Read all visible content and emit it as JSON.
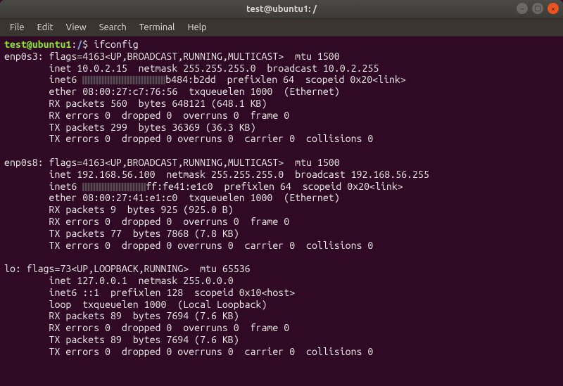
{
  "window": {
    "title": "test@ubuntu1: /"
  },
  "menubar": {
    "items": [
      "File",
      "Edit",
      "View",
      "Search",
      "Terminal",
      "Help"
    ]
  },
  "prompt": {
    "userhost": "test@ubuntu1",
    "sep": ":",
    "path": "/",
    "dollar": "$",
    "command": "ifconfig"
  },
  "output": {
    "enp0s3": {
      "l1": "enp0s3: flags=4163<UP,BROADCAST,RUNNING,MULTICAST>  mtu 1500",
      "l2": "        inet 10.0.2.15  netmask 255.255.255.0  broadcast 10.0.2.255",
      "l3a": "        inet6 ",
      "l3b": "b484:b2dd  prefixlen 64  scopeid 0x20<link>",
      "l4": "        ether 08:00:27:c7:76:56  txqueuelen 1000  (Ethernet)",
      "l5": "        RX packets 560  bytes 648121 (648.1 KB)",
      "l6": "        RX errors 0  dropped 0  overruns 0  frame 0",
      "l7": "        TX packets 299  bytes 36369 (36.3 KB)",
      "l8": "        TX errors 0  dropped 0 overruns 0  carrier 0  collisions 0"
    },
    "enp0s8": {
      "l1": "enp0s8: flags=4163<UP,BROADCAST,RUNNING,MULTICAST>  mtu 1500",
      "l2": "        inet 192.168.56.100  netmask 255.255.255.0  broadcast 192.168.56.255",
      "l3a": "        inet6 ",
      "l3b": "ff:fe41:e1c0  prefixlen 64  scopeid 0x20<link>",
      "l4": "        ether 08:00:27:41:e1:c0  txqueuelen 1000  (Ethernet)",
      "l5": "        RX packets 9  bytes 925 (925.0 B)",
      "l6": "        RX errors 0  dropped 0  overruns 0  frame 0",
      "l7": "        TX packets 77  bytes 7868 (7.8 KB)",
      "l8": "        TX errors 0  dropped 0 overruns 0  carrier 0  collisions 0"
    },
    "lo": {
      "l1": "lo: flags=73<UP,LOOPBACK,RUNNING>  mtu 65536",
      "l2": "        inet 127.0.0.1  netmask 255.0.0.0",
      "l3": "        inet6 ::1  prefixlen 128  scopeid 0x10<host>",
      "l4": "        loop  txqueuelen 1000  (Local Loopback)",
      "l5": "        RX packets 89  bytes 7694 (7.6 KB)",
      "l6": "        RX errors 0  dropped 0  overruns 0  frame 0",
      "l7": "        TX packets 89  bytes 7694 (7.6 KB)",
      "l8": "        TX errors 0  dropped 0 overruns 0  carrier 0  collisions 0"
    }
  }
}
